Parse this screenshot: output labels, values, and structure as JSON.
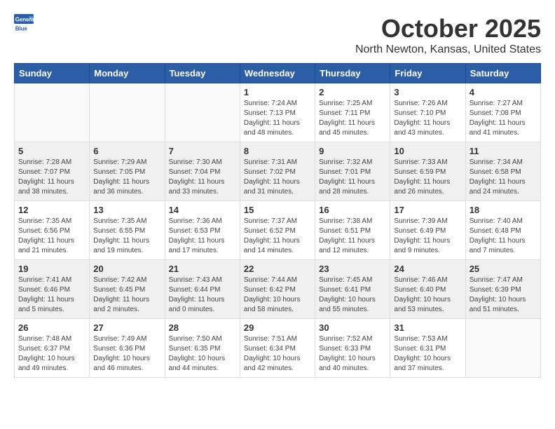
{
  "logo": {
    "general": "General",
    "blue": "Blue"
  },
  "header": {
    "month": "October 2025",
    "location": "North Newton, Kansas, United States"
  },
  "weekdays": [
    "Sunday",
    "Monday",
    "Tuesday",
    "Wednesday",
    "Thursday",
    "Friday",
    "Saturday"
  ],
  "weeks": [
    [
      {
        "day": "",
        "info": ""
      },
      {
        "day": "",
        "info": ""
      },
      {
        "day": "",
        "info": ""
      },
      {
        "day": "1",
        "info": "Sunrise: 7:24 AM\nSunset: 7:13 PM\nDaylight: 11 hours\nand 48 minutes."
      },
      {
        "day": "2",
        "info": "Sunrise: 7:25 AM\nSunset: 7:11 PM\nDaylight: 11 hours\nand 45 minutes."
      },
      {
        "day": "3",
        "info": "Sunrise: 7:26 AM\nSunset: 7:10 PM\nDaylight: 11 hours\nand 43 minutes."
      },
      {
        "day": "4",
        "info": "Sunrise: 7:27 AM\nSunset: 7:08 PM\nDaylight: 11 hours\nand 41 minutes."
      }
    ],
    [
      {
        "day": "5",
        "info": "Sunrise: 7:28 AM\nSunset: 7:07 PM\nDaylight: 11 hours\nand 38 minutes."
      },
      {
        "day": "6",
        "info": "Sunrise: 7:29 AM\nSunset: 7:05 PM\nDaylight: 11 hours\nand 36 minutes."
      },
      {
        "day": "7",
        "info": "Sunrise: 7:30 AM\nSunset: 7:04 PM\nDaylight: 11 hours\nand 33 minutes."
      },
      {
        "day": "8",
        "info": "Sunrise: 7:31 AM\nSunset: 7:02 PM\nDaylight: 11 hours\nand 31 minutes."
      },
      {
        "day": "9",
        "info": "Sunrise: 7:32 AM\nSunset: 7:01 PM\nDaylight: 11 hours\nand 28 minutes."
      },
      {
        "day": "10",
        "info": "Sunrise: 7:33 AM\nSunset: 6:59 PM\nDaylight: 11 hours\nand 26 minutes."
      },
      {
        "day": "11",
        "info": "Sunrise: 7:34 AM\nSunset: 6:58 PM\nDaylight: 11 hours\nand 24 minutes."
      }
    ],
    [
      {
        "day": "12",
        "info": "Sunrise: 7:35 AM\nSunset: 6:56 PM\nDaylight: 11 hours\nand 21 minutes."
      },
      {
        "day": "13",
        "info": "Sunrise: 7:35 AM\nSunset: 6:55 PM\nDaylight: 11 hours\nand 19 minutes."
      },
      {
        "day": "14",
        "info": "Sunrise: 7:36 AM\nSunset: 6:53 PM\nDaylight: 11 hours\nand 17 minutes."
      },
      {
        "day": "15",
        "info": "Sunrise: 7:37 AM\nSunset: 6:52 PM\nDaylight: 11 hours\nand 14 minutes."
      },
      {
        "day": "16",
        "info": "Sunrise: 7:38 AM\nSunset: 6:51 PM\nDaylight: 11 hours\nand 12 minutes."
      },
      {
        "day": "17",
        "info": "Sunrise: 7:39 AM\nSunset: 6:49 PM\nDaylight: 11 hours\nand 9 minutes."
      },
      {
        "day": "18",
        "info": "Sunrise: 7:40 AM\nSunset: 6:48 PM\nDaylight: 11 hours\nand 7 minutes."
      }
    ],
    [
      {
        "day": "19",
        "info": "Sunrise: 7:41 AM\nSunset: 6:46 PM\nDaylight: 11 hours\nand 5 minutes."
      },
      {
        "day": "20",
        "info": "Sunrise: 7:42 AM\nSunset: 6:45 PM\nDaylight: 11 hours\nand 2 minutes."
      },
      {
        "day": "21",
        "info": "Sunrise: 7:43 AM\nSunset: 6:44 PM\nDaylight: 11 hours\nand 0 minutes."
      },
      {
        "day": "22",
        "info": "Sunrise: 7:44 AM\nSunset: 6:42 PM\nDaylight: 10 hours\nand 58 minutes."
      },
      {
        "day": "23",
        "info": "Sunrise: 7:45 AM\nSunset: 6:41 PM\nDaylight: 10 hours\nand 55 minutes."
      },
      {
        "day": "24",
        "info": "Sunrise: 7:46 AM\nSunset: 6:40 PM\nDaylight: 10 hours\nand 53 minutes."
      },
      {
        "day": "25",
        "info": "Sunrise: 7:47 AM\nSunset: 6:39 PM\nDaylight: 10 hours\nand 51 minutes."
      }
    ],
    [
      {
        "day": "26",
        "info": "Sunrise: 7:48 AM\nSunset: 6:37 PM\nDaylight: 10 hours\nand 49 minutes."
      },
      {
        "day": "27",
        "info": "Sunrise: 7:49 AM\nSunset: 6:36 PM\nDaylight: 10 hours\nand 46 minutes."
      },
      {
        "day": "28",
        "info": "Sunrise: 7:50 AM\nSunset: 6:35 PM\nDaylight: 10 hours\nand 44 minutes."
      },
      {
        "day": "29",
        "info": "Sunrise: 7:51 AM\nSunset: 6:34 PM\nDaylight: 10 hours\nand 42 minutes."
      },
      {
        "day": "30",
        "info": "Sunrise: 7:52 AM\nSunset: 6:33 PM\nDaylight: 10 hours\nand 40 minutes."
      },
      {
        "day": "31",
        "info": "Sunrise: 7:53 AM\nSunset: 6:31 PM\nDaylight: 10 hours\nand 37 minutes."
      },
      {
        "day": "",
        "info": ""
      }
    ]
  ]
}
